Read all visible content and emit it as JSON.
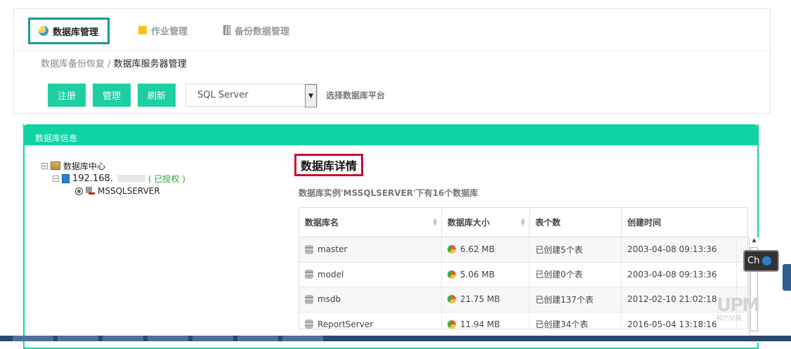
{
  "tabs": [
    {
      "label": "数据库管理",
      "icon": "database-icon",
      "active": true
    },
    {
      "label": "作业管理",
      "icon": "job-icon",
      "active": false
    },
    {
      "label": "备份数据管理",
      "icon": "backup-icon",
      "active": false
    }
  ],
  "breadcrumb": {
    "parent": "数据库备份恢复 /",
    "current": "数据库服务器管理"
  },
  "toolbar": {
    "register": "注册",
    "manage": "管理",
    "refresh": "刷新",
    "platform_value": "SQL Server",
    "platform_hint": "选择数据库平台"
  },
  "panel": {
    "title": "数据库信息"
  },
  "tree": {
    "root": "数据库中心",
    "server_ip": "192.168.",
    "server_status": "( 已授权 )",
    "instance": "MSSQLSERVER"
  },
  "detail": {
    "title": "数据库详情",
    "subtitle": "数据库实例'MSSQLSERVER'下有16个数据库"
  },
  "table": {
    "headers": [
      "数据库名",
      "数据库大小",
      "表个数",
      "创建时间"
    ],
    "rows": [
      {
        "name": "master",
        "size": "6.62 MB",
        "tables": "已创建5个表",
        "created": "2003-04-08 09:13:36"
      },
      {
        "name": "model",
        "size": "5.06 MB",
        "tables": "已创建0个表",
        "created": "2003-04-08 09:13:36"
      },
      {
        "name": "msdb",
        "size": "21.75 MB",
        "tables": "已创建137个表",
        "created": "2012-02-10 21:02:18"
      },
      {
        "name": "ReportServer",
        "size": "11.94 MB",
        "tables": "已创建34个表",
        "created": "2016-05-04 13:18:16"
      }
    ]
  },
  "ime": {
    "label": "Ch"
  },
  "watermark": {
    "logo": "UPM",
    "caption": "和力记易"
  },
  "colors": {
    "accent": "#10d3a5",
    "button": "#1ecfa2",
    "highlight_border": "#c8102e",
    "active_tab_border": "#1a9b8c"
  }
}
